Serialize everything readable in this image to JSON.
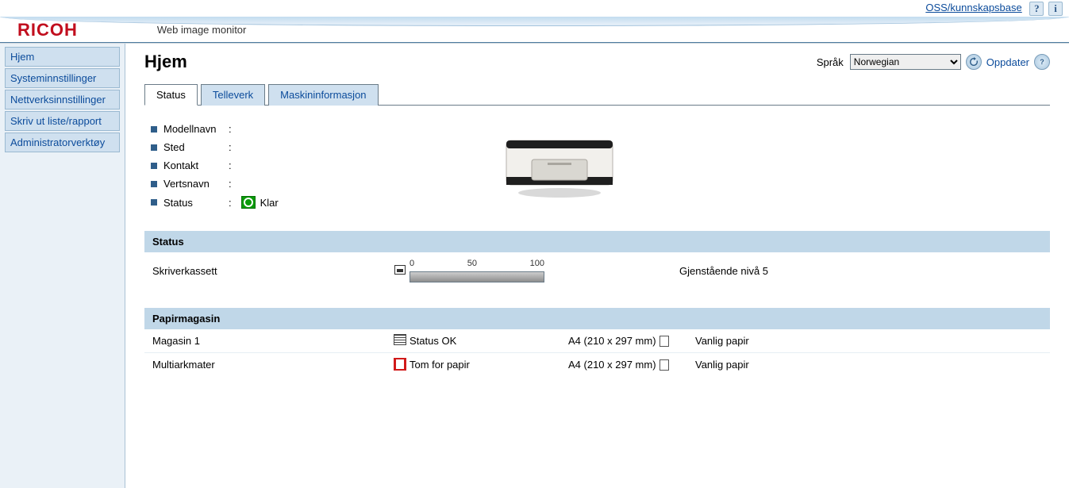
{
  "top": {
    "kb_link": "OSS/kunnskapsbase",
    "help_glyph": "?",
    "info_glyph": "i"
  },
  "header": {
    "logo_text": "RICOH",
    "app_title": "Web image monitor"
  },
  "sidebar": {
    "items": [
      {
        "label": "Hjem"
      },
      {
        "label": "Systeminnstillinger"
      },
      {
        "label": "Nettverksinnstillinger"
      },
      {
        "label": "Skriv ut liste/rapport"
      },
      {
        "label": "Administratorverktøy"
      }
    ]
  },
  "page": {
    "title": "Hjem",
    "lang_label": "Språk",
    "lang_value": "Norwegian",
    "refresh_label": "Oppdater"
  },
  "tabs": [
    {
      "label": "Status",
      "active": true
    },
    {
      "label": "Telleverk",
      "active": false
    },
    {
      "label": "Maskininformasjon",
      "active": false
    }
  ],
  "info": {
    "model_label": "Modellnavn",
    "model_value": "",
    "location_label": "Sted",
    "location_value": "",
    "contact_label": "Kontakt",
    "contact_value": "",
    "host_label": "Vertsnavn",
    "host_value": "",
    "status_label": "Status",
    "status_value": "Klar"
  },
  "sections": {
    "status_title": "Status",
    "tray_title": "Papirmagasin"
  },
  "supply": {
    "name": "Skriverkassett",
    "scale": {
      "min": "0",
      "mid": "50",
      "max": "100"
    },
    "fill_percent": 100,
    "remaining_text": "Gjenstående nivå 5"
  },
  "trays": [
    {
      "name": "Magasin 1",
      "state": "ok",
      "status_text": "Status OK",
      "size": "A4 (210 x 297 mm)",
      "type": "Vanlig papir"
    },
    {
      "name": "Multiarkmater",
      "state": "empty",
      "status_text": "Tom for papir",
      "size": "A4 (210 x 297 mm)",
      "type": "Vanlig papir"
    }
  ]
}
